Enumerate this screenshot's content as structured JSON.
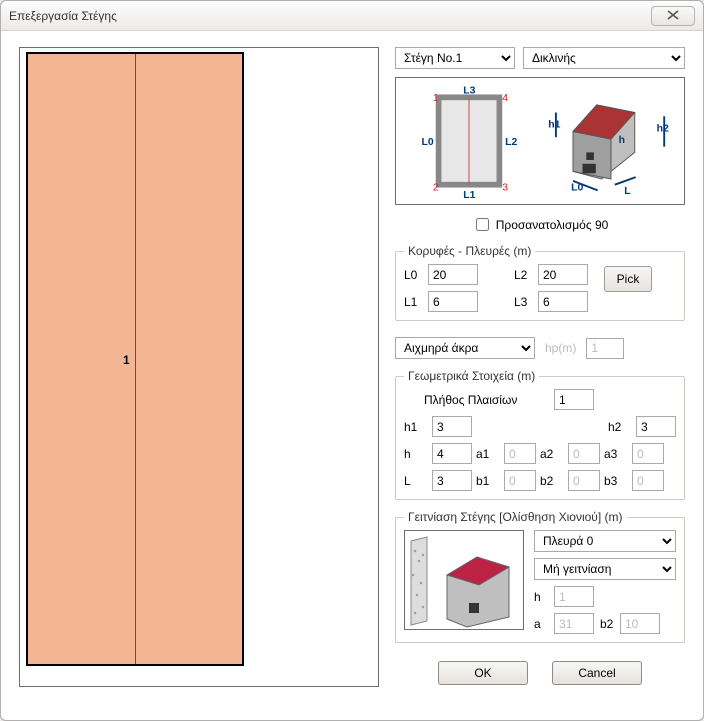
{
  "window": {
    "title": "Επεξεργασία Στέγης"
  },
  "roof_select": {
    "value": "Στέγη Νο.1"
  },
  "type_select": {
    "value": "Δικλινής"
  },
  "diagram": {
    "corners": {
      "c1": "1",
      "c2": "2",
      "c3": "3",
      "c4": "4"
    },
    "edges": {
      "l0": "L0",
      "l1": "L1",
      "l2": "L2",
      "l3": "L3"
    },
    "dims": {
      "h1": "h1",
      "h2": "h2",
      "h": "h",
      "L0": "L0",
      "L": "L"
    }
  },
  "orient90": {
    "label": "Προσανατολισμός 90",
    "checked": false
  },
  "vertices": {
    "legend": "Κορυφές - Πλευρές (m)",
    "L0": {
      "label": "L0",
      "value": "20"
    },
    "L1": {
      "label": "L1",
      "value": "6"
    },
    "L2": {
      "label": "L2",
      "value": "20"
    },
    "L3": {
      "label": "L3",
      "value": "6"
    },
    "pick": "Pick"
  },
  "edges_select": {
    "value": "Αιχμηρά άκρα"
  },
  "hp": {
    "label": "hp(m)",
    "value": "1"
  },
  "geom": {
    "legend": "Γεωμετρικά Στοιχεία (m)",
    "frames_label": "Πλήθος Πλαισίων",
    "frames_value": "1",
    "h1": {
      "label": "h1",
      "value": "3"
    },
    "h2": {
      "label": "h2",
      "value": "3"
    },
    "h": {
      "label": "h",
      "value": "4"
    },
    "L": {
      "label": "L",
      "value": "3"
    },
    "a1": {
      "label": "a1",
      "value": "0"
    },
    "a2": {
      "label": "a2",
      "value": "0"
    },
    "a3": {
      "label": "a3",
      "value": "0"
    },
    "b1": {
      "label": "b1",
      "value": "0"
    },
    "b2": {
      "label": "b2",
      "value": "0"
    },
    "b3": {
      "label": "b3",
      "value": "0"
    }
  },
  "neigh": {
    "legend": "Γειτνίαση Στέγης [Ολίσθηση Χιονιού] (m)",
    "side": "Πλευρά 0",
    "relation": "Μή γειτνίαση",
    "h": {
      "label": "h",
      "value": "1"
    },
    "a": {
      "label": "a",
      "value": "31"
    },
    "b2": {
      "label": "b2",
      "value": "10"
    }
  },
  "buttons": {
    "ok": "OK",
    "cancel": "Cancel"
  },
  "canvas": {
    "label": "1"
  }
}
